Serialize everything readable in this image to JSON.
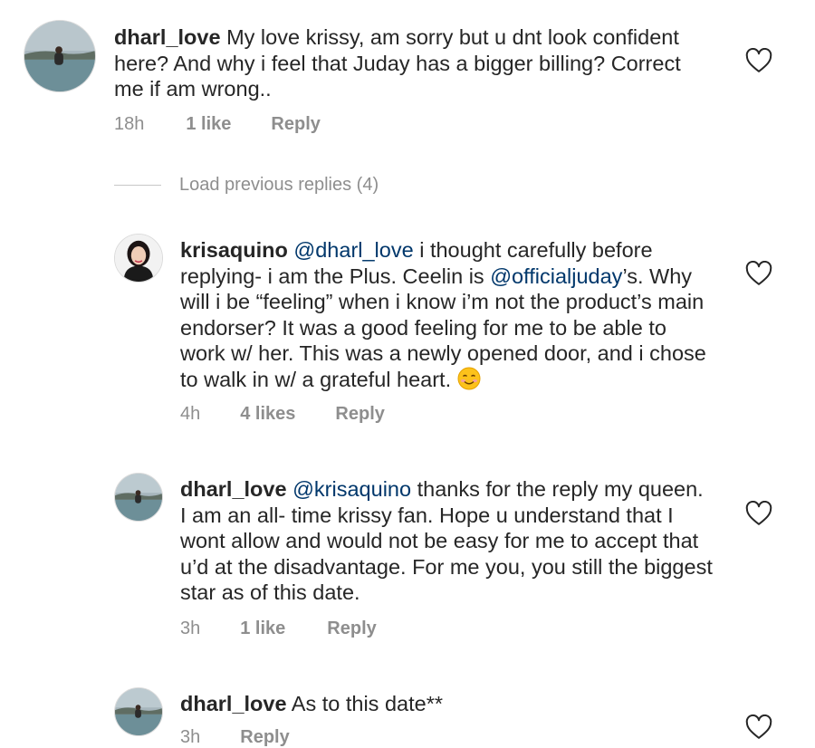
{
  "comments": [
    {
      "username": "dharl_love",
      "mention": "",
      "text": " My love krissy, am sorry but u dnt look confident\nhere? And why i feel that Juday has a bigger billing? Correct\nme if am wrong..",
      "time": "18h",
      "likes": "1 like",
      "reply": "Reply",
      "icons": {
        "avatar": "avatar-photo",
        "like": "heart-outline-icon"
      }
    },
    {
      "username": "krisaquino",
      "mention": "@dharl_love",
      "text_a": " i thought carefully before\nreplying- i am the Plus. Ceelin is ",
      "mention2": "@officialjuday",
      "text_b": "’s. Why\nwill i be “feeling” when i know i’m not the product’s main\nendorser? It was a good feeling for me to be able to\nwork w/ her. This was a newly opened door, and i chose\nto walk in w/ a grateful heart. ",
      "time": "4h",
      "likes": "4 likes",
      "reply": "Reply",
      "icons": {
        "emoji": "smiling-face-emoji",
        "like": "heart-outline-icon"
      }
    },
    {
      "username": "dharl_love",
      "mention": "@krisaquino",
      "text": " thanks for the reply my queen.\nI am an all- time krissy fan. Hope u understand that I\nwont allow  and would not be easy for me to accept that\nu’d at the disadvantage. For me you, you still the biggest\nstar as of this date.",
      "time": "3h",
      "likes": "1 like",
      "reply": "Reply"
    },
    {
      "username": "dharl_love",
      "text": " As to this date**",
      "time": "3h",
      "reply": "Reply"
    }
  ],
  "load_previous": "Load previous replies (4)",
  "colors": {
    "text": "#262626",
    "meta": "#8e8e8e",
    "mention": "#00376b",
    "divider": "#c7c7c7"
  }
}
